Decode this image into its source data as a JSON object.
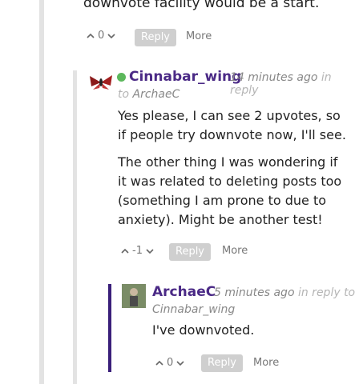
{
  "top_comment": {
    "text_tail": "downvote facility would be a start.",
    "vote_count": "0",
    "reply_label": "Reply",
    "more_label": "More"
  },
  "comment_cinnabar": {
    "author": "Cinnabar_wing",
    "time": "14 minutes ago",
    "in_reply_prefix": "in reply",
    "to_word": "to",
    "reply_to": "ArchaeC",
    "paragraphs": [
      "Yes please, I can see 2 upvotes, so if people try downvote now, I'll see.",
      "The other thing I was wondering if it was related to deleting posts too (something I am prone to due to anxiety). Might be another test!"
    ],
    "vote_count": "-1",
    "reply_label": "Reply",
    "more_label": "More",
    "online": true
  },
  "comment_archaec": {
    "author": "ArchaeC",
    "time": "5 minutes ago",
    "in_reply_prefix": "in reply to",
    "reply_to": "Cinnabar_wing",
    "text": "I've downvoted.",
    "vote_count": "0",
    "reply_label": "Reply",
    "more_label": "More"
  },
  "colors": {
    "author": "#4b2a86",
    "online_dot": "#5cb85c",
    "nested_border": "#3a1f7a",
    "rail": "#e3e3e3"
  }
}
